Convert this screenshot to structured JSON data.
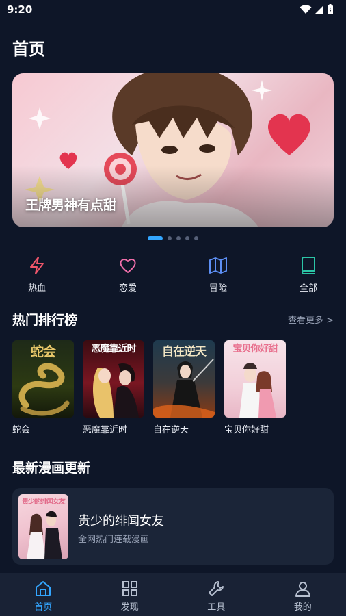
{
  "status": {
    "time": "9:20"
  },
  "page": {
    "title": "首页"
  },
  "banner": {
    "title": "王牌男神有点甜"
  },
  "carousel": {
    "count": 5,
    "active_index": 0
  },
  "categories": [
    {
      "label": "热血",
      "icon": "lightning-icon",
      "color": "#f0566b"
    },
    {
      "label": "恋爱",
      "icon": "heart-icon",
      "color": "#f06faa"
    },
    {
      "label": "冒险",
      "icon": "map-icon",
      "color": "#5d8ff5"
    },
    {
      "label": "全部",
      "icon": "book-icon",
      "color": "#2bc4a6"
    }
  ],
  "ranking": {
    "title": "热门排行榜",
    "more_label": "查看更多 >",
    "items": [
      {
        "name": "蛇会",
        "cover_text": "蛇会"
      },
      {
        "name": "恶魔靠近时",
        "cover_text": "恶魔靠近时"
      },
      {
        "name": "自在逆天",
        "cover_text": "自在逆天"
      },
      {
        "name": "宝贝你好甜",
        "cover_text": "宝贝你好甜"
      }
    ]
  },
  "latest": {
    "title": "最新漫画更新",
    "item": {
      "title": "贵少的绯闻女友",
      "subtitle": "全网热门连载漫画",
      "cover_text": "贵少的绯闻女友"
    }
  },
  "nav": [
    {
      "label": "首页",
      "icon": "home-icon",
      "active": true
    },
    {
      "label": "发现",
      "icon": "grid-icon",
      "active": false
    },
    {
      "label": "工具",
      "icon": "wrench-icon",
      "active": false
    },
    {
      "label": "我的",
      "icon": "user-icon",
      "active": false
    }
  ],
  "colors": {
    "accent": "#33a6ff",
    "background": "#0e1628",
    "card": "#1b2538"
  }
}
